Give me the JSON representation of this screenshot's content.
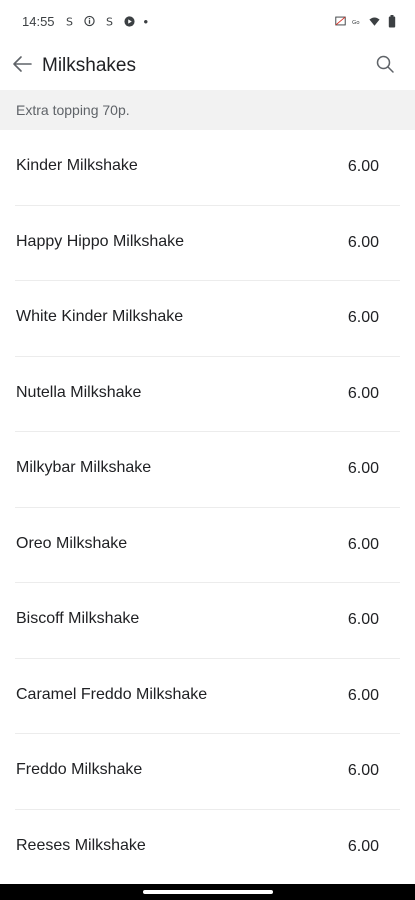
{
  "status_bar": {
    "time": "14:55",
    "left_icons": [
      "skype-icon",
      "info-circle-icon",
      "skype-icon",
      "play-icon"
    ],
    "dot": "•",
    "right_icons": [
      "no-sim-icon",
      "data-icon",
      "wifi-icon",
      "battery-icon"
    ]
  },
  "app_bar": {
    "title": "Milkshakes"
  },
  "banner": {
    "text": "Extra topping 70p."
  },
  "menu": {
    "items": [
      {
        "name": "Kinder Milkshake",
        "price": "6.00"
      },
      {
        "name": "Happy Hippo Milkshake",
        "price": "6.00"
      },
      {
        "name": "White Kinder Milkshake",
        "price": "6.00"
      },
      {
        "name": "Nutella Milkshake",
        "price": "6.00"
      },
      {
        "name": "Milkybar Milkshake",
        "price": "6.00"
      },
      {
        "name": "Oreo Milkshake",
        "price": "6.00"
      },
      {
        "name": "Biscoff Milkshake",
        "price": "6.00"
      },
      {
        "name": "Caramel Freddo Milkshake",
        "price": "6.00"
      },
      {
        "name": "Freddo Milkshake",
        "price": "6.00"
      },
      {
        "name": "Reeses Milkshake",
        "price": "6.00"
      }
    ]
  }
}
